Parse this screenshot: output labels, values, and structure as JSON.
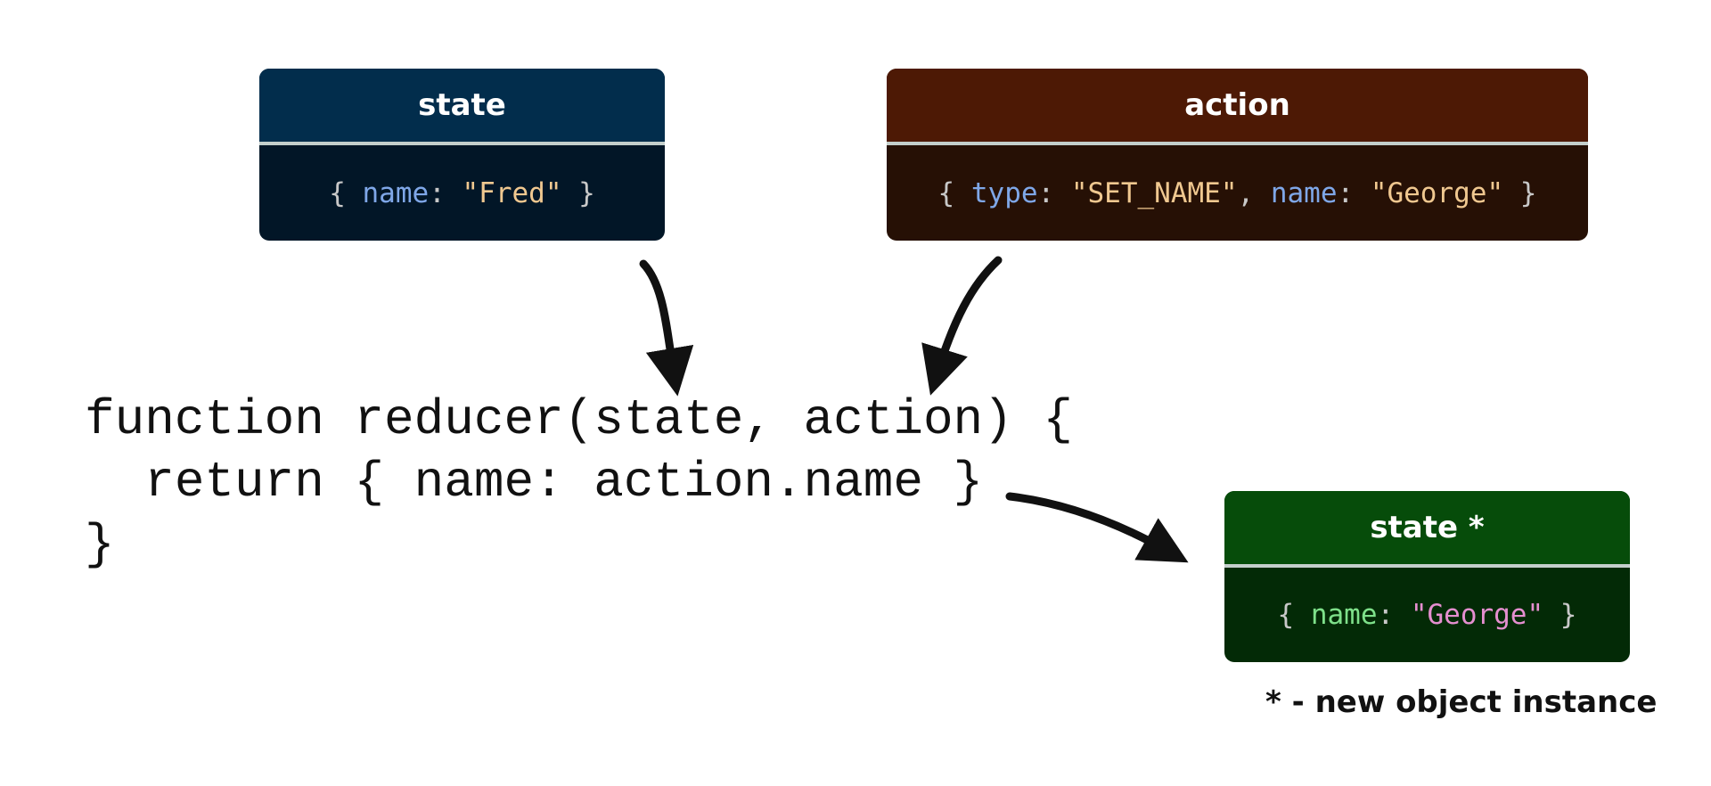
{
  "state_box": {
    "title": "state",
    "open": "{ ",
    "key": "name",
    "colon": ": ",
    "value": "\"Fred\"",
    "close": " }",
    "colors": {
      "header": "#022d4c",
      "body": "#021627",
      "key": "#7fa7e8",
      "value": "#f0c890"
    }
  },
  "action_box": {
    "title": "action",
    "open": "{ ",
    "key1": "type",
    "colon1": ": ",
    "value1": "\"SET_NAME\"",
    "sep": ", ",
    "key2": "name",
    "colon2": ": ",
    "value2": "\"George\"",
    "close": " }",
    "colors": {
      "header": "#4d1905",
      "body": "#261005",
      "key": "#7fa7e8",
      "value": "#f0c890"
    }
  },
  "new_state_box": {
    "title": "state *",
    "open": "{ ",
    "key": "name",
    "colon": ": ",
    "value": "\"George\"",
    "close": " }",
    "colors": {
      "header": "#064c0a",
      "body": "#032a06",
      "key": "#7ee08a",
      "value": "#e58fd0"
    }
  },
  "code": {
    "line1": "function reducer(state, action) {",
    "line2": "  return { name: action.name }",
    "line3": "}"
  },
  "footnote": "* - new object instance"
}
